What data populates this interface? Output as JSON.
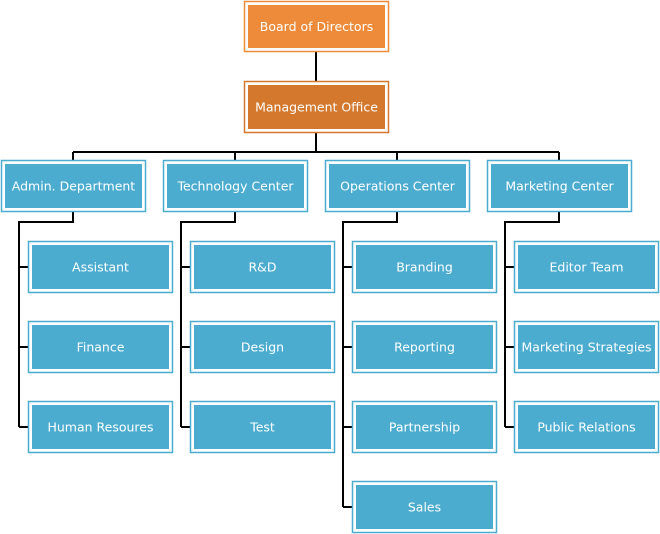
{
  "colors": {
    "board": "#EE8B3A",
    "management": "#D4782E",
    "department": "#4BACD0",
    "connector": "#000000"
  },
  "board": {
    "label": "Board of Directors"
  },
  "management": {
    "label": "Management Office"
  },
  "departments": [
    {
      "label": "Admin. Department",
      "children": [
        "Assistant",
        "Finance",
        "Human Resoures"
      ]
    },
    {
      "label": "Technology Center",
      "children": [
        "R&D",
        "Design",
        "Test"
      ]
    },
    {
      "label": "Operations Center",
      "children": [
        "Branding",
        "Reporting",
        "Partnership",
        "Sales"
      ]
    },
    {
      "label": "Marketing Center",
      "children": [
        "Editor Team",
        "Marketing Strategies",
        "Public Relations"
      ]
    }
  ]
}
